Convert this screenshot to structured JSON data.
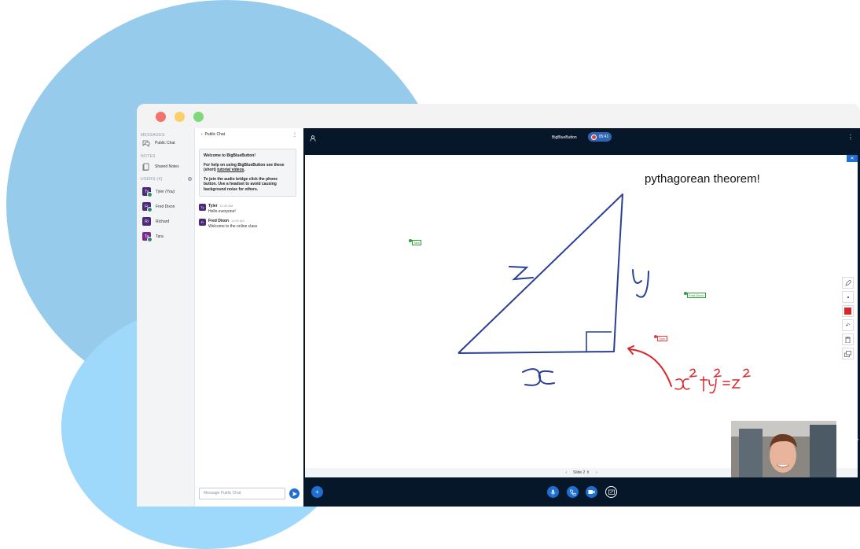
{
  "sidebar": {
    "messages_title": "MESSAGES",
    "public_chat": "Public Chat",
    "notes_title": "NOTES",
    "shared_notes": "Shared Notes",
    "users_title": "USERS (4)",
    "users": [
      {
        "initials": "Ty",
        "name": "Tyler",
        "suffix": "(You)"
      },
      {
        "initials": "Fr",
        "name": "Fred Dixon"
      },
      {
        "initials": "Ri",
        "name": "Richard"
      },
      {
        "initials": "Ta",
        "name": "Tara"
      }
    ]
  },
  "chat": {
    "header": "Public Chat",
    "welcome_title": "Welcome to BigBlueButton!",
    "welcome_help": "For help on using BigBlueButton see these (short)",
    "welcome_link": "tutorial videos",
    "welcome_audio": "To join the audio bridge click the phone button. Use a headset to avoid causing background noise for others.",
    "messages": [
      {
        "initials": "Ty",
        "name": "Tyler",
        "time": "11:00 AM",
        "text": "Hello everyone!"
      },
      {
        "initials": "Fr",
        "name": "Fred Dixon",
        "time": "11:00 AM",
        "text": "Welcome to the online class"
      }
    ],
    "input_placeholder": "Message Public Chat"
  },
  "topbar": {
    "title": "BigBlueButton",
    "recording_time": "05:41"
  },
  "whiteboard": {
    "title": "pythagorean theorem!",
    "cursors": [
      {
        "name": "Tara",
        "color": "#2e9d3a"
      },
      {
        "name": "Fred Dixon",
        "color": "#2e9d3a"
      },
      {
        "name": "Tyler",
        "color": "#e53f3f"
      }
    ],
    "slide_label": "Slide 2",
    "stroke_blue": "#2a3f96",
    "stroke_red": "#d9262c"
  },
  "colors": {
    "brand_blue": "#1e6fd0",
    "dark_bg": "#06172a"
  }
}
